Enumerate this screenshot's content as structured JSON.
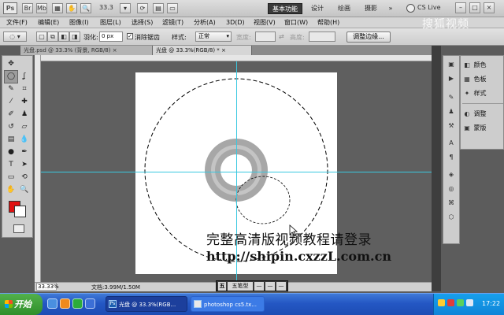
{
  "app": {
    "logo": "Ps",
    "zoom_value": "33.3",
    "workspaces": [
      "基本功能",
      "设计",
      "绘画",
      "摄影"
    ],
    "workspace_more": "»",
    "cs_live": "CS Live",
    "win_buttons": [
      "–",
      "□",
      "×"
    ]
  },
  "menu": [
    "文件(F)",
    "编辑(E)",
    "图像(I)",
    "图层(L)",
    "选择(S)",
    "滤镜(T)",
    "分析(A)",
    "3D(D)",
    "视图(V)",
    "窗口(W)",
    "帮助(H)"
  ],
  "options": {
    "feather_label": "羽化:",
    "feather_value": "0 px",
    "antialias_label": "消除锯齿",
    "style_label": "样式:",
    "style_value": "正常",
    "width_label": "宽度:",
    "height_label": "高度:",
    "refine_edge": "调整边缘..."
  },
  "watermark_top": "搜狐视频",
  "tabs": [
    {
      "label": "光盘.psd @ 33.3% (背景, RGB/8)",
      "active": false,
      "close": "×"
    },
    {
      "label": "光盘 @ 33.3%(RGB/8) *",
      "active": true,
      "close": "×"
    }
  ],
  "panels": [
    {
      "icon": "color-icon",
      "label": "颜色"
    },
    {
      "icon": "swatches-icon",
      "label": "色板"
    },
    {
      "icon": "styles-icon",
      "label": "样式"
    },
    {
      "icon": "adjustments-icon",
      "label": "调整"
    },
    {
      "icon": "masks-icon",
      "label": "蒙版"
    }
  ],
  "status": {
    "zoom": "33.33%",
    "doc_info": "文档:3.99M/1.50M",
    "mini_labels": [
      "五笔型",
      "—",
      "—",
      "—"
    ]
  },
  "captions": {
    "line1": "完整高清版视频教程请登录",
    "line2": "http://shipin.cxzzL.com.cn"
  },
  "taskbar": {
    "start": "开始",
    "tasks": [
      {
        "label": "光盘 @ 33.3%(RGB...",
        "active": true
      },
      {
        "label": "photoshop cs5.tx...",
        "active": false
      }
    ],
    "clock": "17:22"
  },
  "colors": {
    "foreground": "#e01010",
    "background": "#ffffff",
    "guide": "#39c8e0",
    "ring_outer": "#a7a7a7",
    "ring_inner": "#c4c4c4"
  }
}
